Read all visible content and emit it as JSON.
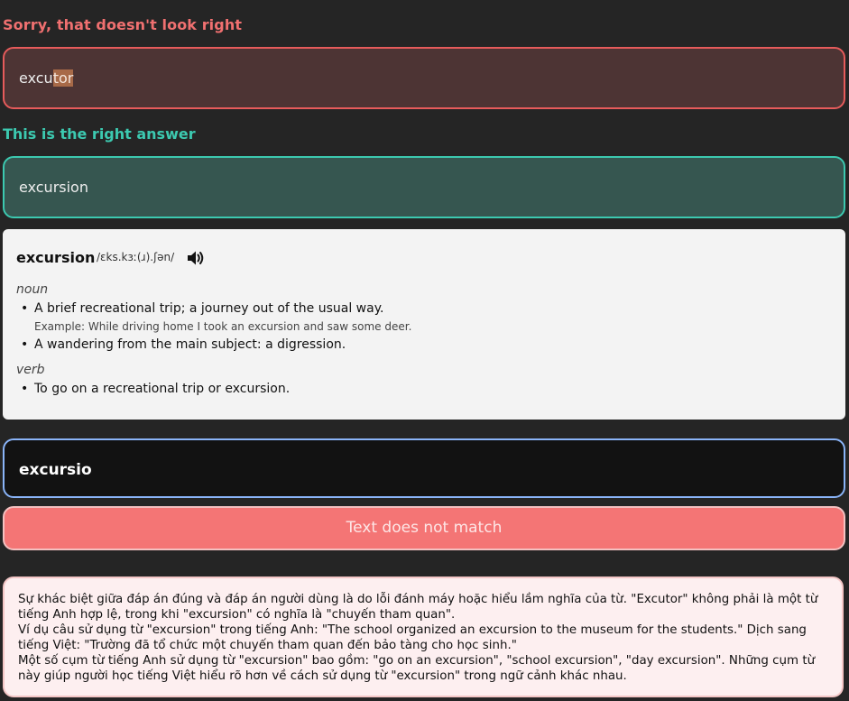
{
  "feedback": {
    "error_label": "Sorry, that doesn't look right",
    "user_answer_prefix": "excu",
    "user_answer_highlight": "tor",
    "correct_label": "This is the right answer",
    "correct_answer": "excursion"
  },
  "dictionary": {
    "word": "excursion",
    "ipa": "/ɛks.kɜː(ɹ).ʃən/",
    "speaker_icon": "speaker-icon",
    "noun": {
      "pos": "noun",
      "definitions": [
        {
          "text": "A brief recreational trip; a journey out of the usual way.",
          "example": "Example: While driving home I took an excursion and saw some deer."
        },
        {
          "text": "A wandering from the main subject: a digression."
        }
      ]
    },
    "verb": {
      "pos": "verb",
      "definitions": [
        {
          "text": "To go on a recreational trip or excursion."
        }
      ]
    }
  },
  "answer_input": {
    "value": "excursio"
  },
  "status_button": {
    "label": "Text does not match"
  },
  "explanation": {
    "lines": [
      "Sự khác biệt giữa đáp án đúng và đáp án người dùng là do lỗi đánh máy hoặc hiểu lầm nghĩa của từ. \"Excutor\" không phải là một từ tiếng Anh hợp lệ, trong khi \"excursion\" có nghĩa là \"chuyến tham quan\".",
      "Ví dụ câu sử dụng từ \"excursion\" trong tiếng Anh: \"The school organized an excursion to the museum for the students.\" Dịch sang tiếng Việt: \"Trường đã tổ chức một chuyến tham quan đến bảo tàng cho học sinh.\"",
      "Một số cụm từ tiếng Anh sử dụng từ \"excursion\" bao gồm: \"go on an excursion\", \"school excursion\", \"day excursion\". Những cụm từ này giúp người học tiếng Việt hiểu rõ hơn về cách sử dụng từ \"excursion\" trong ngữ cảnh khác nhau."
    ]
  },
  "colors": {
    "error": "#e65b5b",
    "correct": "#3cc9b0",
    "input_border": "#8ab4f8",
    "status_button": "#f47575"
  }
}
